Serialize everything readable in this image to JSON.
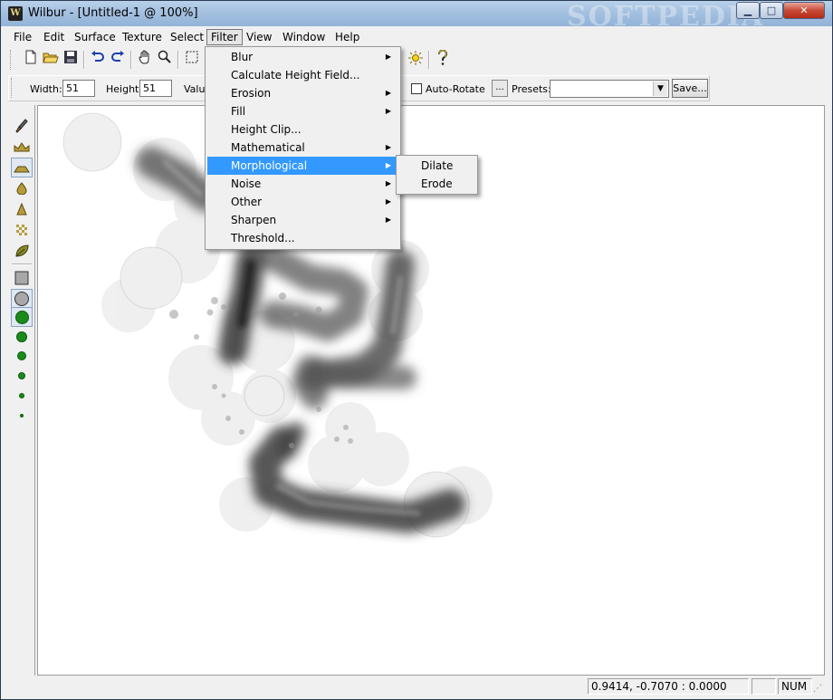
{
  "window": {
    "title": "Wilbur - [Untitled-1 @ 100%]",
    "app_icon_letter": "W",
    "controls": {
      "minimize": "▁",
      "maximize": "□",
      "close": "✕"
    }
  },
  "menubar": {
    "items": [
      "File",
      "Edit",
      "Surface",
      "Texture",
      "Select",
      "Filter",
      "View",
      "Window",
      "Help"
    ],
    "open_menu": "Filter"
  },
  "toolbar": {
    "icons": [
      "new-icon",
      "open-icon",
      "save-icon",
      "undo-icon",
      "redo-icon",
      "hand-icon",
      "zoom-icon",
      "select-rect-icon",
      "light-icon",
      "help-icon"
    ]
  },
  "options_bar": {
    "width_label": "Width:",
    "width_value": "51",
    "height_label": "Height:",
    "height_value": "51",
    "value_label": "Valu",
    "autorotate_label": "Auto-Rotate",
    "autorotate_checked": false,
    "ellipsis_label": "...",
    "presets_label": "Presets:",
    "presets_value": "",
    "save_label": "Save..."
  },
  "toolbox": {
    "tools": [
      "brush-icon",
      "terrain-raise-icon",
      "terrain-plateau-icon",
      "drop-icon",
      "cone-icon",
      "noise-icon",
      "leaf-icon",
      "square-shape-icon",
      "circle-shape-icon"
    ],
    "brush_sizes": [
      "size-6",
      "size-5",
      "size-4",
      "size-3",
      "size-2",
      "size-1"
    ],
    "colors": {
      "brush_dot": "#1a8a1a"
    }
  },
  "filter_menu": {
    "items": [
      {
        "label": "Blur",
        "submenu": true
      },
      {
        "label": "Calculate Height Field...",
        "submenu": false
      },
      {
        "label": "Erosion",
        "submenu": true
      },
      {
        "label": "Fill",
        "submenu": true
      },
      {
        "label": "Height Clip...",
        "submenu": false
      },
      {
        "label": "Mathematical",
        "submenu": true
      },
      {
        "label": "Morphological",
        "submenu": true
      },
      {
        "label": "Noise",
        "submenu": true
      },
      {
        "label": "Other",
        "submenu": true
      },
      {
        "label": "Sharpen",
        "submenu": true
      },
      {
        "label": "Threshold...",
        "submenu": false
      }
    ],
    "highlighted": "Morphological",
    "highlight_color": "#3399ff"
  },
  "morph_submenu": {
    "items": [
      "Dilate",
      "Erode"
    ]
  },
  "statusbar": {
    "coordinates": "0.9414, -0.7070 : 0.0000",
    "num_indicator": "NUM"
  },
  "watermark": "SOFTPEDIA"
}
